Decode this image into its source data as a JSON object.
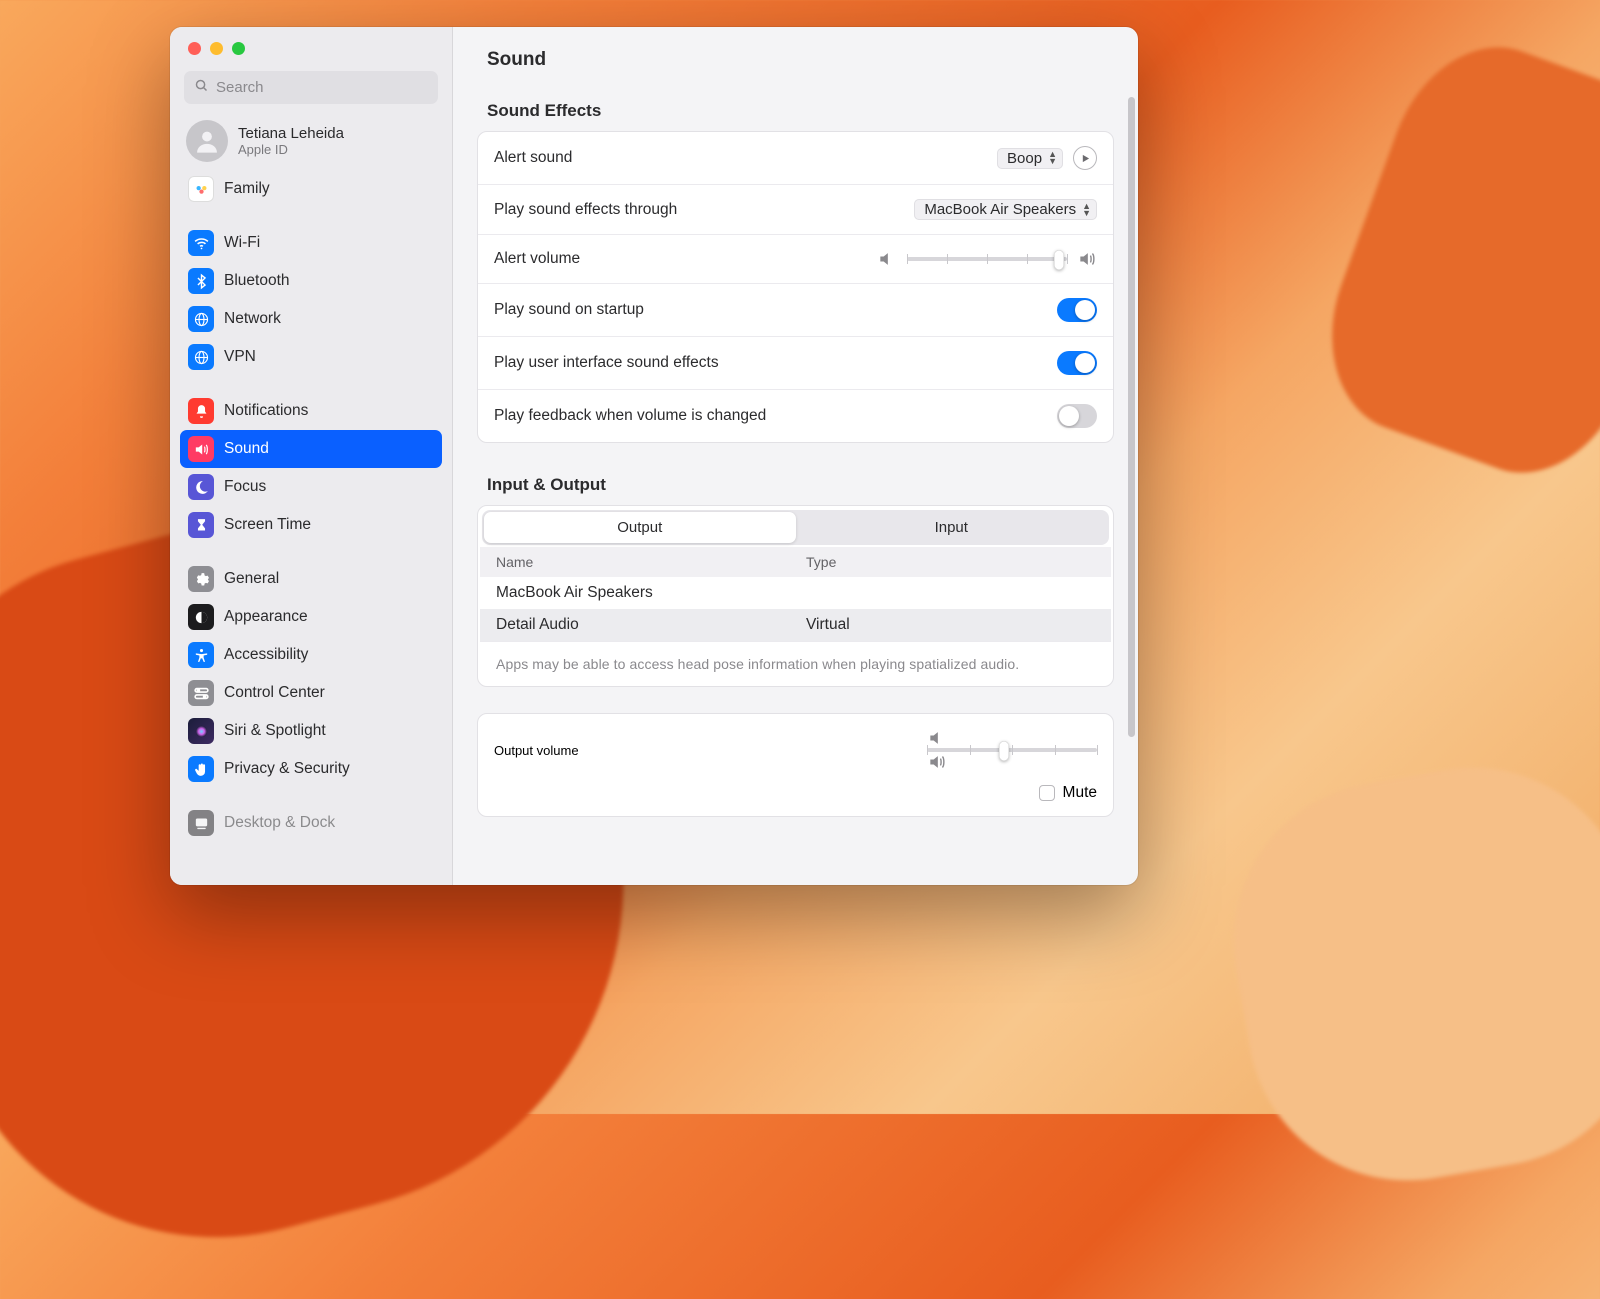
{
  "window": {
    "title": "Sound"
  },
  "search": {
    "placeholder": "Search"
  },
  "account": {
    "name": "Tetiana Leheida",
    "sub": "Apple ID"
  },
  "sidebar": {
    "items": [
      {
        "label": "Family"
      },
      {
        "label": "Wi-Fi"
      },
      {
        "label": "Bluetooth"
      },
      {
        "label": "Network"
      },
      {
        "label": "VPN"
      },
      {
        "label": "Notifications"
      },
      {
        "label": "Sound"
      },
      {
        "label": "Focus"
      },
      {
        "label": "Screen Time"
      },
      {
        "label": "General"
      },
      {
        "label": "Appearance"
      },
      {
        "label": "Accessibility"
      },
      {
        "label": "Control Center"
      },
      {
        "label": "Siri & Spotlight"
      },
      {
        "label": "Privacy & Security"
      },
      {
        "label": "Desktop & Dock"
      }
    ]
  },
  "sections": {
    "effects_title": "Sound Effects",
    "io_title": "Input & Output"
  },
  "effects": {
    "alert_sound_label": "Alert sound",
    "alert_sound_value": "Boop",
    "play_through_label": "Play sound effects through",
    "play_through_value": "MacBook Air Speakers",
    "alert_volume_label": "Alert volume",
    "alert_volume_percent": 95,
    "startup_label": "Play sound on startup",
    "startup_on": true,
    "ui_sounds_label": "Play user interface sound effects",
    "ui_sounds_on": true,
    "feedback_label": "Play feedback when volume is changed",
    "feedback_on": false
  },
  "io": {
    "tabs": {
      "output": "Output",
      "input": "Input",
      "active": "Output"
    },
    "columns": {
      "name": "Name",
      "type": "Type"
    },
    "rows": [
      {
        "name": "MacBook Air Speakers",
        "type": ""
      },
      {
        "name": "Detail Audio",
        "type": "Virtual"
      }
    ],
    "note": "Apps may be able to access head pose information when playing spatialized audio."
  },
  "output": {
    "volume_label": "Output volume",
    "volume_percent": 45,
    "mute_label": "Mute",
    "mute_checked": false
  }
}
